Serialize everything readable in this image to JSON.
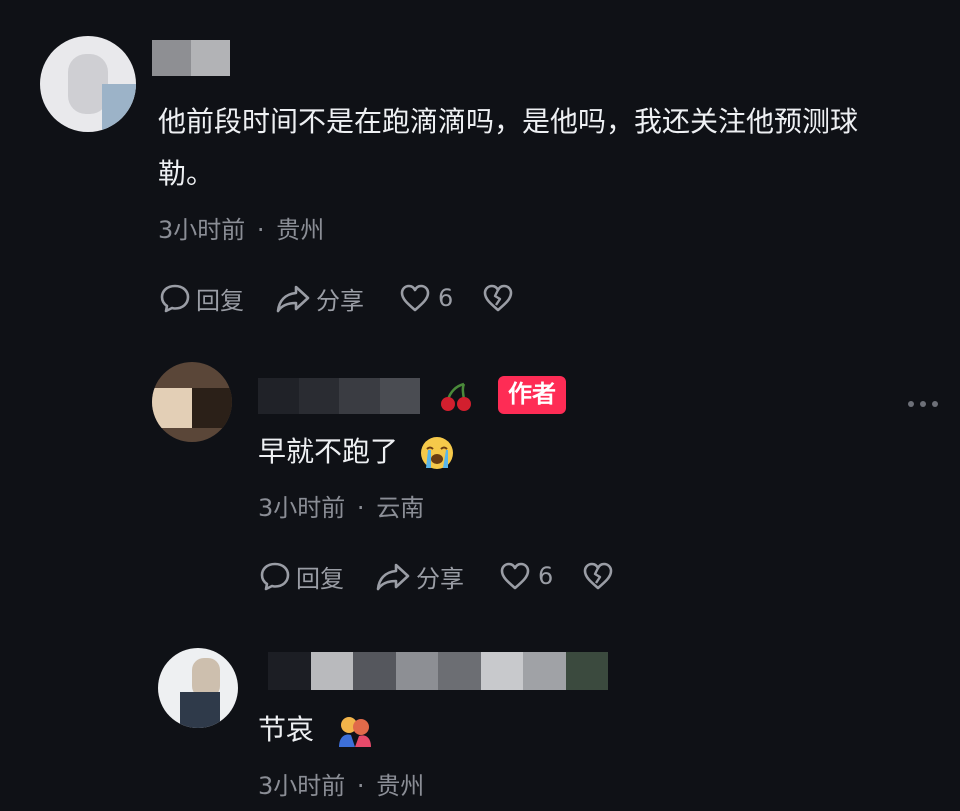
{
  "comments": [
    {
      "text_line1": "他前段时间不是在跑滴滴吗，是他吗，我还关注他预测球",
      "text_line2": "勒。",
      "time": "3小时前",
      "sep": "·",
      "location": "贵州",
      "reply_label": "回复",
      "share_label": "分享",
      "like_count": "6"
    },
    {
      "badge": "作者",
      "text": "早就不跑了",
      "emoji": "loudly-crying-face",
      "time": "3小时前",
      "sep": "·",
      "location": "云南",
      "reply_label": "回复",
      "share_label": "分享",
      "like_count": "6"
    },
    {
      "text": "节哀",
      "emoji": "hugging-people",
      "time": "3小时前",
      "sep": "·",
      "location": "贵州"
    }
  ],
  "colors": {
    "background": "#0f1116",
    "author_badge": "#fe2c55",
    "meta": "#8b8e96"
  }
}
